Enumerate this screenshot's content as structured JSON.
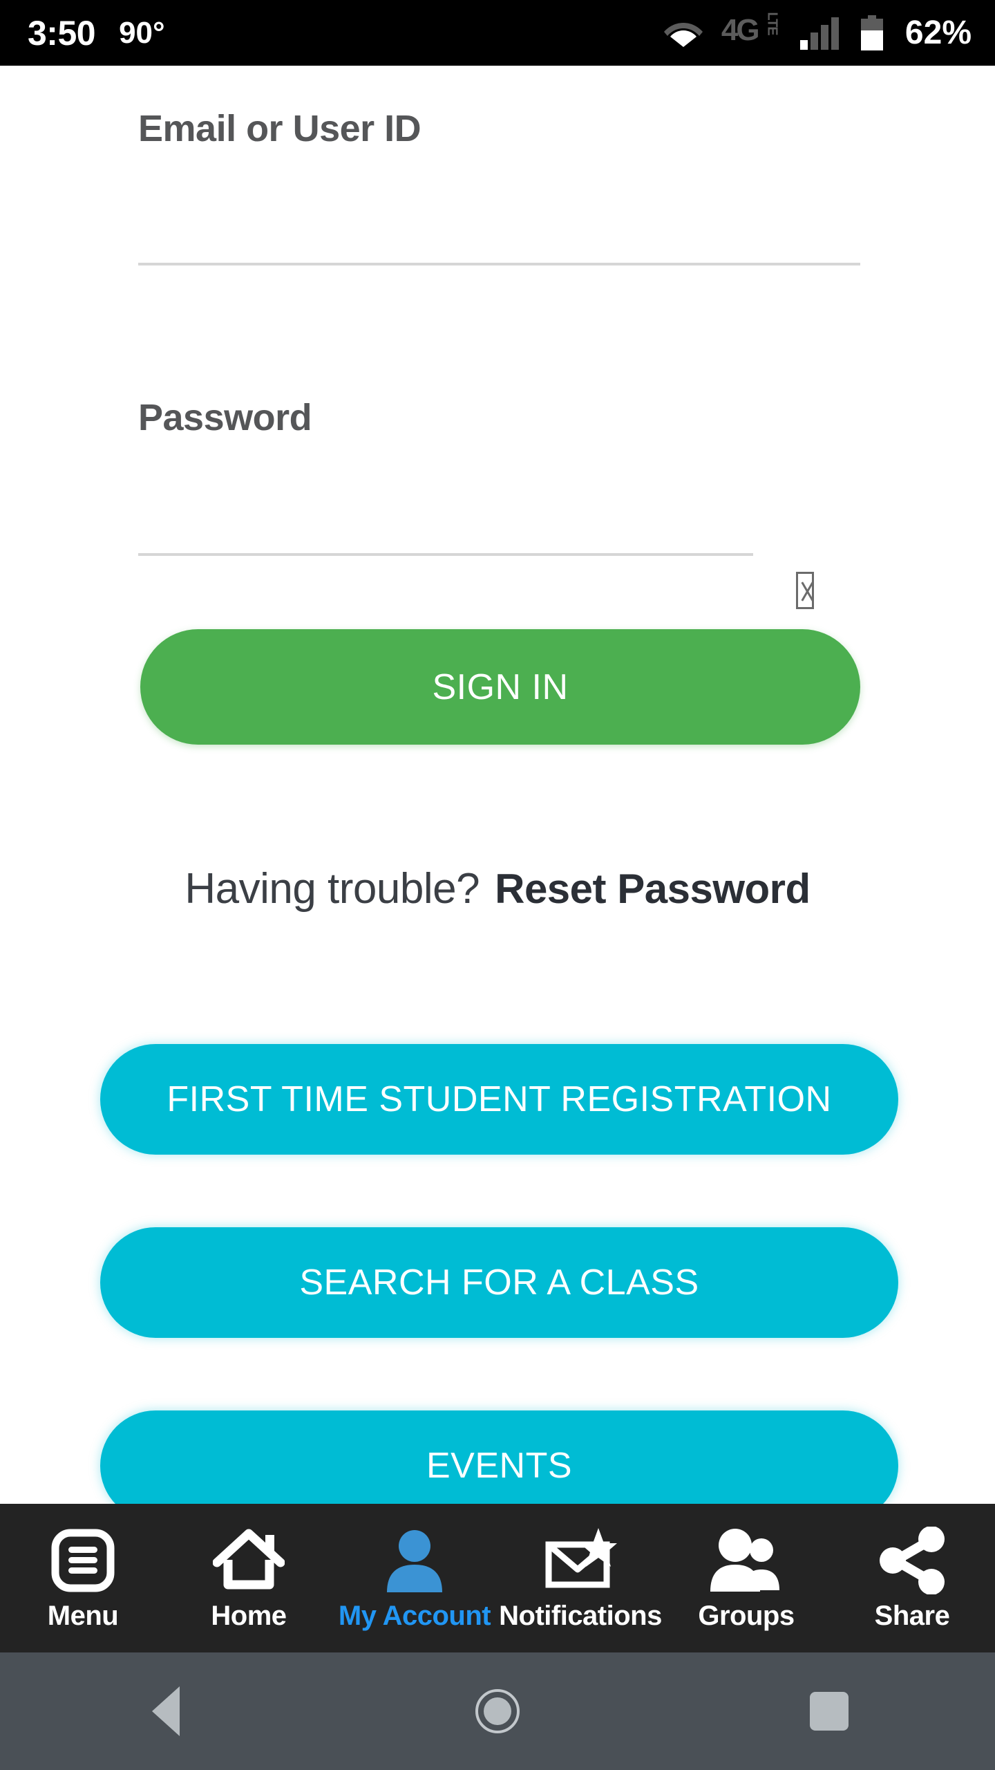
{
  "status_bar": {
    "time": "3:50",
    "temperature": "90°",
    "network_type": "4G",
    "network_sub": "LTE",
    "battery_percent": "62%",
    "icons": {
      "wifi": "wifi-icon",
      "network": "4g-lte-icon",
      "signal": "signal-bars-icon",
      "battery": "battery-icon"
    },
    "signal_bars_total": 4,
    "signal_bars_filled": 1,
    "background_color": "#000000",
    "text_color": "#ffffff"
  },
  "login_form": {
    "email_label": "Email or User ID",
    "email_value": "",
    "email_placeholder": "",
    "password_label": "Password",
    "password_value": "",
    "password_placeholder": "",
    "password_reveal_icon": "missing-glyph-box-icon",
    "sign_in_label": "SIGN IN",
    "sign_in_color": "#4caf50",
    "trouble_text": "Having trouble?",
    "reset_password_label": "Reset Password"
  },
  "actions": {
    "accent_color": "#00bcd4",
    "buttons": [
      {
        "label": "FIRST TIME STUDENT REGISTRATION",
        "name": "first-time-registration"
      },
      {
        "label": "SEARCH FOR A CLASS",
        "name": "search-class"
      },
      {
        "label": "EVENTS",
        "name": "events"
      }
    ]
  },
  "bottom_nav": {
    "background_color": "#232323",
    "active_color": "#2196f3",
    "items": [
      {
        "label": "Menu",
        "icon": "menu-list-icon",
        "active": false
      },
      {
        "label": "Home",
        "icon": "home-icon",
        "active": false
      },
      {
        "label": "My Account",
        "icon": "person-icon",
        "active": true
      },
      {
        "label": "Notifications",
        "icon": "envelope-star-icon",
        "active": false
      },
      {
        "label": "Groups",
        "icon": "people-group-icon",
        "active": false
      },
      {
        "label": "Share",
        "icon": "share-nodes-icon",
        "active": false
      }
    ]
  },
  "system_nav": {
    "background_color": "#4a5056",
    "buttons": [
      {
        "name": "back",
        "icon": "triangle-back-icon"
      },
      {
        "name": "home",
        "icon": "circle-home-icon"
      },
      {
        "name": "recents",
        "icon": "square-recents-icon"
      }
    ]
  }
}
